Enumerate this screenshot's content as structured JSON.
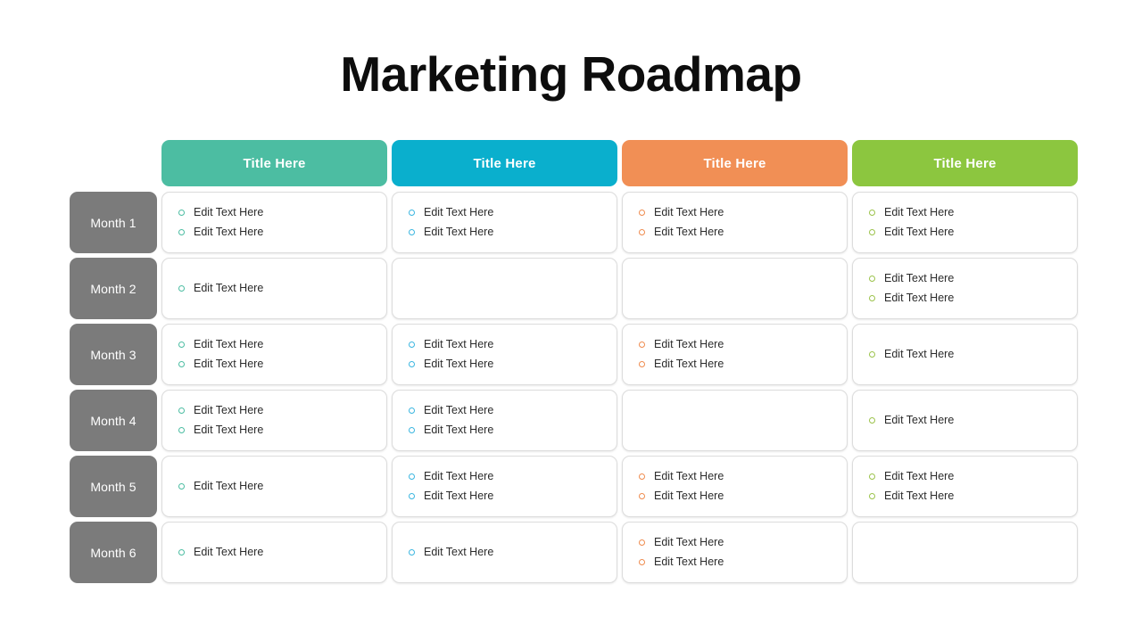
{
  "page_title": "Marketing Roadmap",
  "columns": [
    {
      "label": "Title Here",
      "color": "#4cbda2",
      "bullet_color": "#4cbda2"
    },
    {
      "label": "Title Here",
      "color": "#0aafcd",
      "bullet_color": "#3bb6e0"
    },
    {
      "label": "Title Here",
      "color": "#f18f55",
      "bullet_color": "#ef8b4e"
    },
    {
      "label": "Title Here",
      "color": "#8cc63f",
      "bullet_color": "#9bc24a"
    }
  ],
  "bullet_icon": "hollow-circle-bullet-icon",
  "item_label": "Edit Text Here",
  "month_color": "#7b7b7b",
  "rows": [
    {
      "label": "Month 1",
      "cells": [
        {
          "items": [
            "Edit Text Here",
            "Edit Text Here"
          ]
        },
        {
          "items": [
            "Edit Text Here",
            "Edit Text Here"
          ]
        },
        {
          "items": [
            "Edit Text Here",
            "Edit Text Here"
          ]
        },
        {
          "items": [
            "Edit Text Here",
            "Edit Text Here"
          ]
        }
      ]
    },
    {
      "label": "Month 2",
      "cells": [
        {
          "items": [
            "Edit Text Here"
          ]
        },
        {
          "items": []
        },
        {
          "items": []
        },
        {
          "items": [
            "Edit Text Here",
            "Edit Text Here"
          ]
        }
      ]
    },
    {
      "label": "Month 3",
      "cells": [
        {
          "items": [
            "Edit Text Here",
            "Edit Text Here"
          ]
        },
        {
          "items": [
            "Edit Text Here",
            "Edit Text Here"
          ]
        },
        {
          "items": [
            "Edit Text Here",
            "Edit Text Here"
          ]
        },
        {
          "items": [
            "Edit Text Here"
          ]
        }
      ]
    },
    {
      "label": "Month 4",
      "cells": [
        {
          "items": [
            "Edit Text Here",
            "Edit Text Here"
          ]
        },
        {
          "items": [
            "Edit Text Here",
            "Edit Text Here"
          ]
        },
        {
          "items": []
        },
        {
          "items": [
            "Edit Text Here"
          ]
        }
      ]
    },
    {
      "label": "Month 5",
      "cells": [
        {
          "items": [
            "Edit Text Here"
          ]
        },
        {
          "items": [
            "Edit Text Here",
            "Edit Text Here"
          ]
        },
        {
          "items": [
            "Edit Text Here",
            "Edit Text Here"
          ]
        },
        {
          "items": [
            "Edit Text Here",
            "Edit Text Here"
          ]
        }
      ]
    },
    {
      "label": "Month 6",
      "cells": [
        {
          "items": [
            "Edit Text Here"
          ]
        },
        {
          "items": [
            "Edit Text Here"
          ]
        },
        {
          "items": [
            "Edit Text Here",
            "Edit Text Here"
          ]
        },
        {
          "items": []
        }
      ]
    }
  ]
}
